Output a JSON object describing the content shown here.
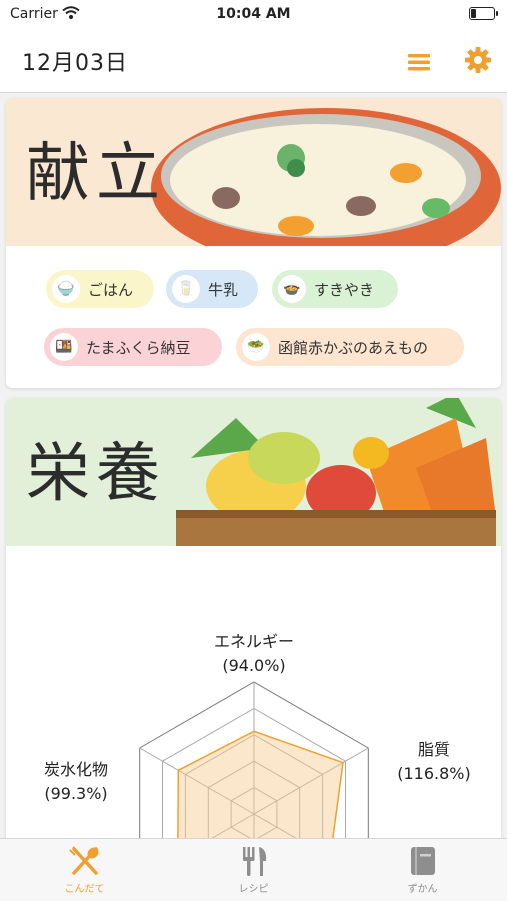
{
  "status_bar": {
    "carrier": "Carrier",
    "time": "10:04 AM",
    "battery_level": 0.25
  },
  "nav": {
    "title": "12月03日",
    "accent": "#f0a030"
  },
  "menu_card": {
    "title": "献立",
    "items": [
      {
        "label": "ごはん",
        "color": "#fbf6c9",
        "icon": "rice-icon"
      },
      {
        "label": "牛乳",
        "color": "#d6e8f8",
        "icon": "milk-icon"
      },
      {
        "label": "すきやき",
        "color": "#d8f2d3",
        "icon": "sukiyaki-icon"
      },
      {
        "label": "たまふくら納豆",
        "color": "#fbd3d6",
        "icon": "natto-icon"
      },
      {
        "label": "函館赤かぶのあえもの",
        "color": "#fde5cf",
        "icon": "aemono-icon"
      }
    ]
  },
  "nutrition_card": {
    "title": "栄養",
    "axes": [
      {
        "name": "エネルギー",
        "value_text": "(94.0%)",
        "value": 94.0
      },
      {
        "name": "脂質",
        "value_text": "(116.8%)",
        "value": 116.8
      },
      {
        "name": "炭水化物",
        "value_text": "(99.3%)",
        "value": 99.3
      }
    ],
    "fill_color": "#f6c98c"
  },
  "tabbar": {
    "tabs": [
      {
        "label": "こんだて",
        "icon": "fork-spoon-icon",
        "active": true
      },
      {
        "label": "レシピ",
        "icon": "cutlery-icon",
        "active": false
      },
      {
        "label": "ずかん",
        "icon": "book-icon",
        "active": false
      }
    ],
    "active_color": "#f0a030",
    "inactive_color": "#8e8e8e"
  }
}
